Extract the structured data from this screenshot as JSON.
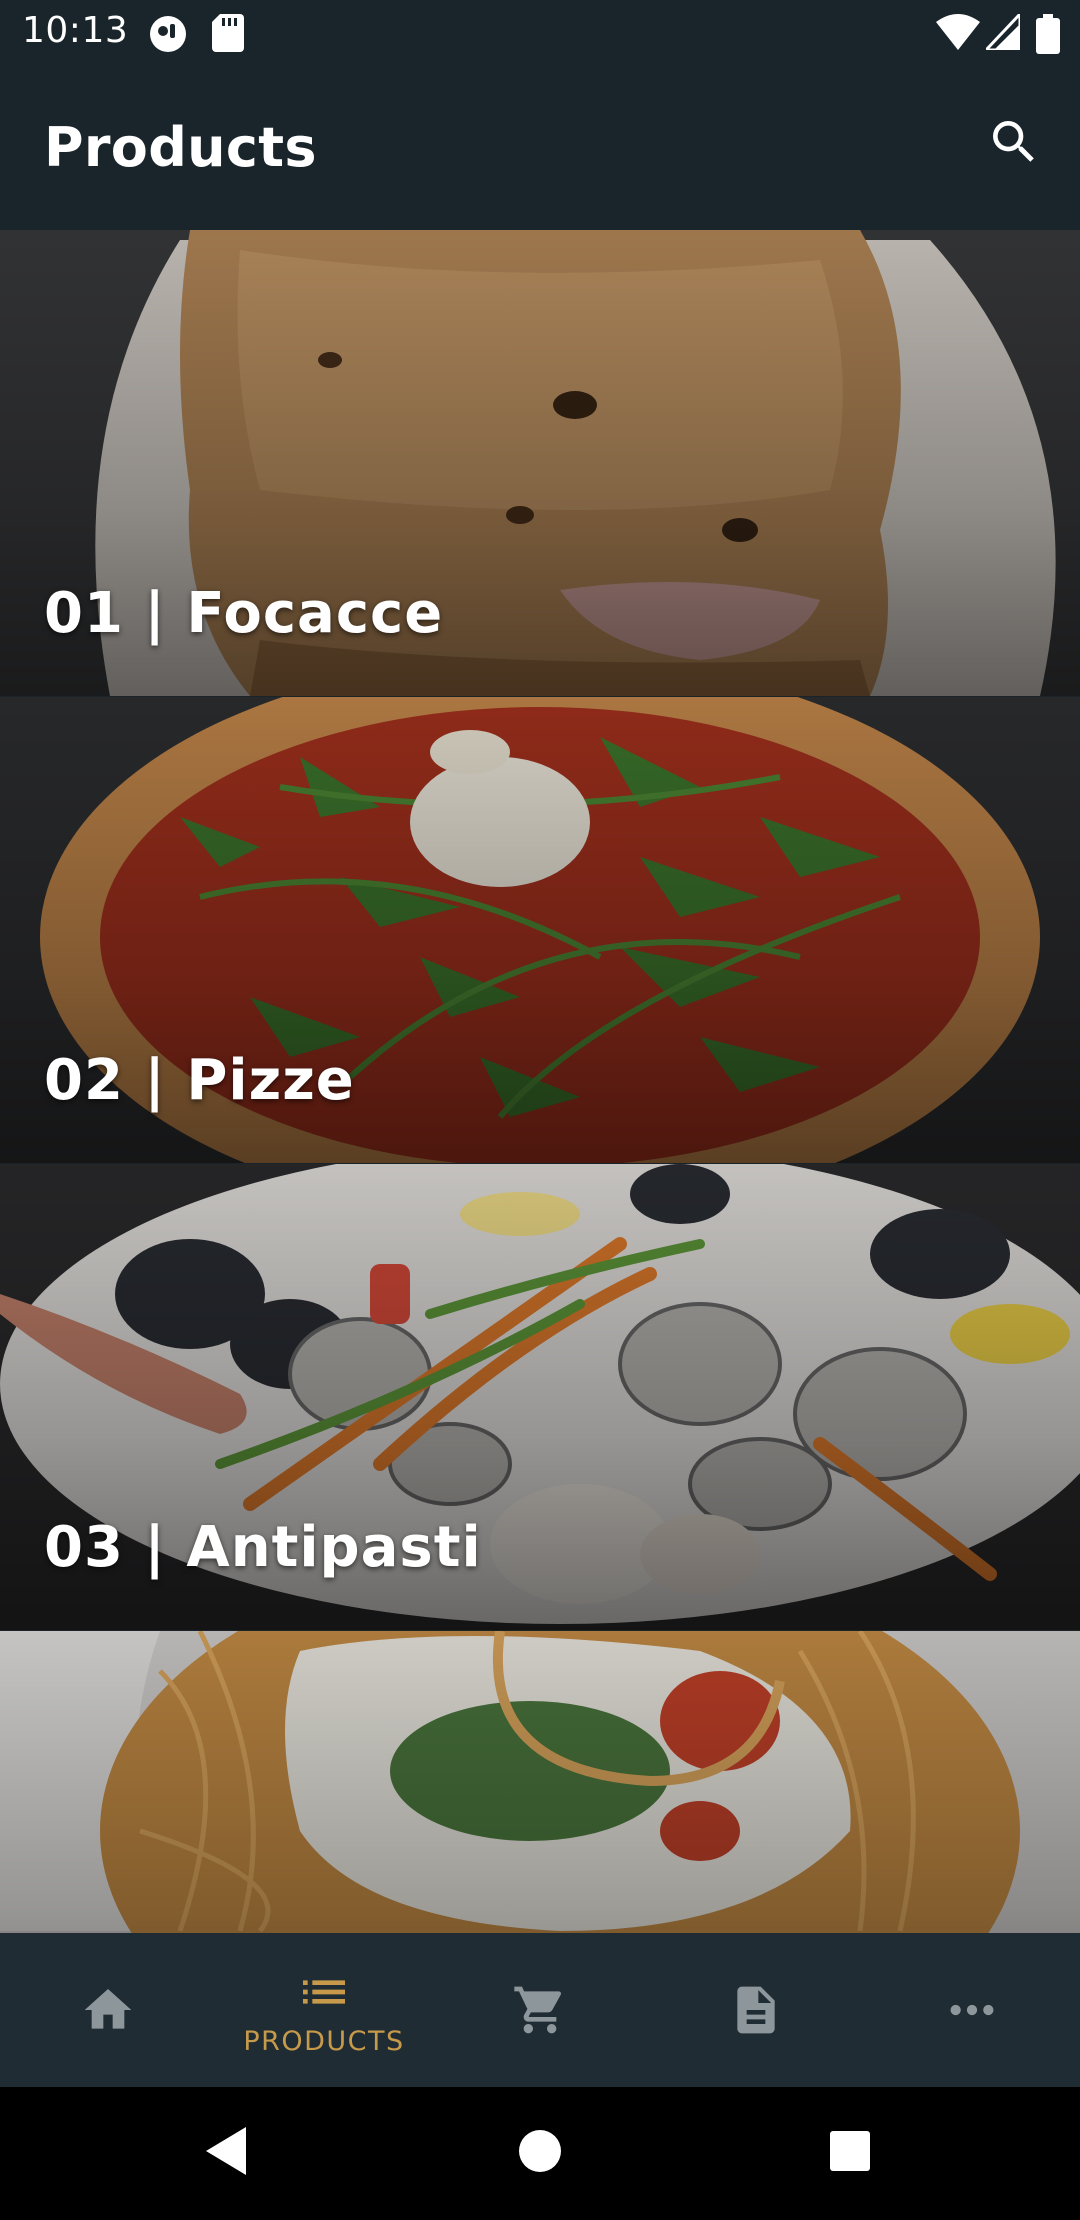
{
  "status_bar": {
    "time": "10:13",
    "icons_left": [
      "privacy-indicator-icon",
      "sd-card-icon"
    ],
    "icons_right": [
      "wifi-icon",
      "cellular-signal-icon",
      "battery-icon"
    ]
  },
  "app_bar": {
    "title": "Products",
    "search_icon": "search-icon"
  },
  "categories": [
    {
      "label": "01 | Focacce",
      "image": "focaccia-photo"
    },
    {
      "label": "02 | Pizze",
      "image": "pizza-photo"
    },
    {
      "label": "03 | Antipasti",
      "image": "seafood-antipasti-photo"
    },
    {
      "label": "",
      "image": "spaghetti-photo"
    }
  ],
  "bottom_nav": {
    "items": [
      {
        "icon": "home-icon",
        "label": ""
      },
      {
        "icon": "list-icon",
        "label": "PRODUCTS",
        "selected": true
      },
      {
        "icon": "cart-icon",
        "label": ""
      },
      {
        "icon": "document-icon",
        "label": ""
      },
      {
        "icon": "more-icon",
        "label": ""
      }
    ],
    "inactive_color": "#8d969b",
    "active_color": "#c69a4a"
  },
  "system_nav": {
    "icons": [
      "back-icon",
      "home-circle-icon",
      "recents-icon"
    ]
  }
}
